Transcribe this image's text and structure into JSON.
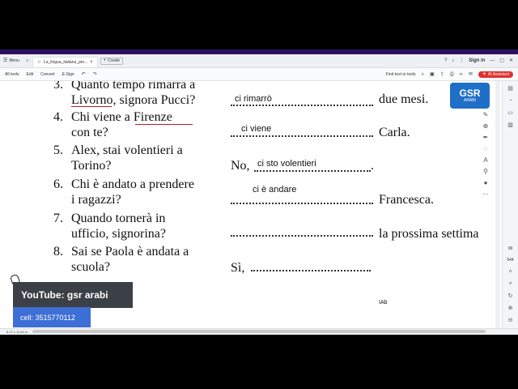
{
  "tabbar": {
    "menu_label": "Menu",
    "tab_title": "La_lingua_italiana_per...",
    "create_label": "Create",
    "signin_label": "Sign in"
  },
  "toolbar": {
    "all_tools": "All tools",
    "edit": "Edit",
    "convert": "Convert",
    "esign": "E-Sign",
    "find_placeholder": "Find text or tools",
    "ai_label": "AI Assistant"
  },
  "exercise": {
    "questions": [
      {
        "num": "3.",
        "line1": "Quanto tempo rimarrà a",
        "line2": "Livorno, signora Pucci?",
        "answer": "ci rimarrò",
        "tail": "due mesi."
      },
      {
        "num": "4.",
        "line1": "Chi viene a Firenze",
        "line2": "con te?",
        "answer": "ci viene",
        "tail": "Carla."
      },
      {
        "num": "5.",
        "line1": "Alex, stai volentieri a",
        "line2": "Torino?",
        "prefix": "No,",
        "answer": "ci sto volentieri",
        "tail": "."
      },
      {
        "num": "6.",
        "line1": "Chi è andato a prendere",
        "line2": "i ragazzi?",
        "answer": "ci è andare",
        "tail": "Francesca."
      },
      {
        "num": "7.",
        "line1": "Quando tornerà in",
        "line2": "ufficio, signorina?",
        "answer": "",
        "tail": "la prossima settima"
      },
      {
        "num": "8.",
        "line1": "Sai se Paola è andata a",
        "line2": "scuola?",
        "prefix": "Sì,",
        "answer": "",
        "tail": ""
      }
    ]
  },
  "overlay": {
    "youtube": "YouTube: gsr arabi",
    "cell": "cell: 3515770112",
    "logo_main": "GSR",
    "logo_sub": "ARABI"
  },
  "sidebar": {
    "page_current": "99",
    "page_total": "544"
  },
  "statusbar": {
    "size": "8.27 x 11.69 in"
  },
  "cursor_text": "IAb"
}
